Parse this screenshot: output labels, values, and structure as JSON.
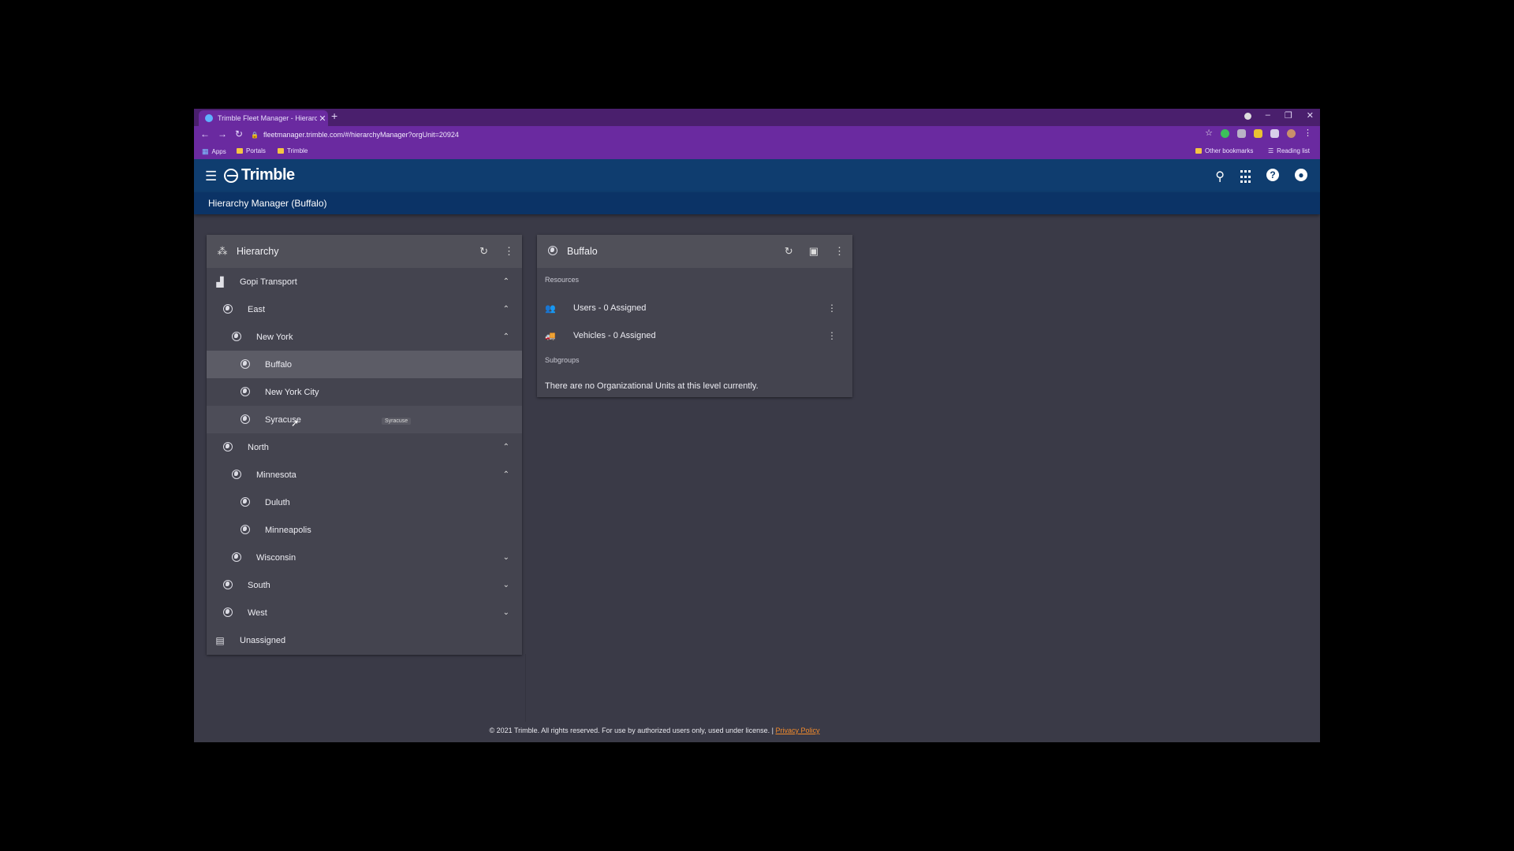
{
  "browser": {
    "tab_title": "Trimble Fleet Manager - Hierarc",
    "tab_close": "✕",
    "new_tab": "+",
    "url": "fleetmanager.trimble.com/#/hierarchyManager?orgUnit=20924",
    "bookmarks": [
      "Apps",
      "Portals",
      "Trimble"
    ],
    "other_bookmarks": "Other bookmarks",
    "reading_list": "Reading list",
    "colors": {
      "tab_strip": "#4a1f6d",
      "toolbar": "#6a2aa0"
    }
  },
  "app": {
    "brand": "Trimble",
    "page_title": "Hierarchy Manager (Buffalo)",
    "colors": {
      "appbar": "#0f3d6f",
      "subbar": "#0b3366",
      "background": "#3a3a47",
      "accent_link": "#f28b2c"
    }
  },
  "hierarchy": {
    "title": "Hierarchy",
    "items": [
      {
        "label": "Gopi Transport",
        "icon": "company-icon",
        "chevron": "up"
      },
      {
        "label": "East",
        "icon": "globe-icon",
        "chevron": "up"
      },
      {
        "label": "New York",
        "icon": "globe-icon",
        "chevron": "up"
      },
      {
        "label": "Buffalo",
        "icon": "globe-icon",
        "selected": true
      },
      {
        "label": "New York City",
        "icon": "globe-icon"
      },
      {
        "label": "Syracuse",
        "icon": "globe-icon",
        "hovered": true
      },
      {
        "label": "North",
        "icon": "globe-icon",
        "chevron": "up"
      },
      {
        "label": "Minnesota",
        "icon": "globe-icon",
        "chevron": "up"
      },
      {
        "label": "Duluth",
        "icon": "globe-icon"
      },
      {
        "label": "Minneapolis",
        "icon": "globe-icon"
      },
      {
        "label": "Wisconsin",
        "icon": "globe-icon",
        "chevron": "down"
      },
      {
        "label": "South",
        "icon": "globe-icon",
        "chevron": "down"
      },
      {
        "label": "West",
        "icon": "globe-icon",
        "chevron": "down"
      },
      {
        "label": "Unassigned",
        "icon": "unassigned-folder-icon"
      }
    ],
    "tooltip": "Syracuse"
  },
  "detail": {
    "title": "Buffalo",
    "resources_label": "Resources",
    "resources": [
      {
        "label": "Users - 0 Assigned",
        "icon": "users-icon"
      },
      {
        "label": "Vehicles - 0 Assigned",
        "icon": "truck-icon"
      }
    ],
    "subgroups_label": "Subgroups",
    "empty_message": "There are no Organizational Units at this level currently."
  },
  "footer": {
    "text": "© 2021 Trimble. All rights reserved. For use by authorized users only, used under license. |",
    "privacy_link": "Privacy Policy"
  }
}
